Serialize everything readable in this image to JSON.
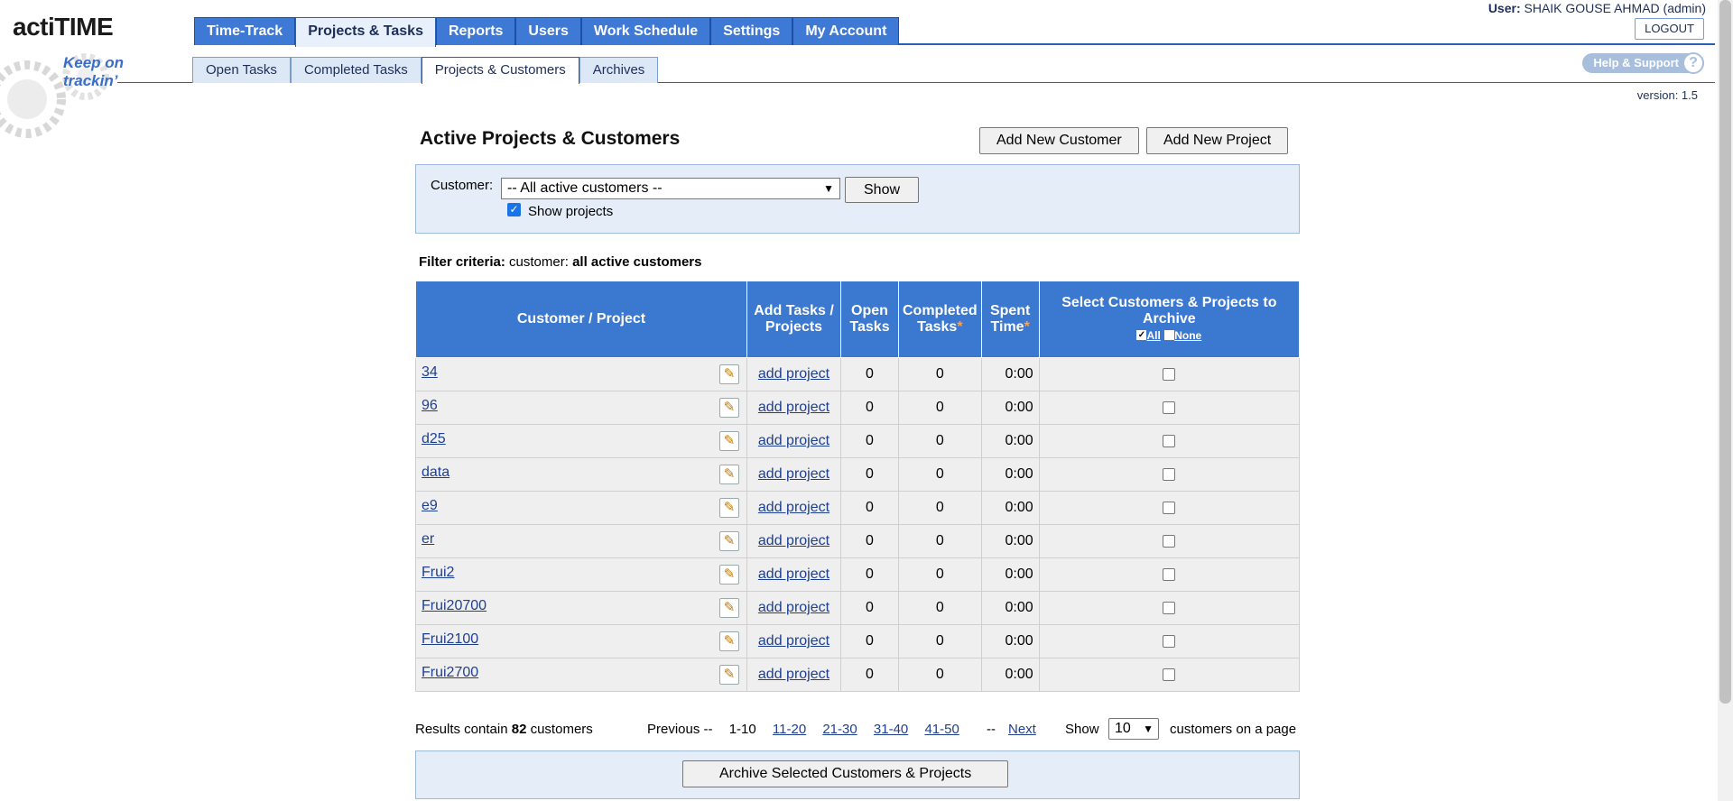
{
  "header": {
    "logo_text": "actiTIME",
    "tagline": "Keep on trackin’",
    "user_label": "User:",
    "user_name": "SHAIK GOUSE AHMAD (admin)",
    "logout_label": "LOGOUT",
    "help_label": "Help & Support",
    "help_icon": "?",
    "version": "version: 1.5",
    "top_tabs": [
      "Time-Track",
      "Projects & Tasks",
      "Reports",
      "Users",
      "Work Schedule",
      "Settings",
      "My Account"
    ],
    "active_top_tab": "Projects & Tasks",
    "sub_tabs": [
      "Open Tasks",
      "Completed Tasks",
      "Projects & Customers",
      "Archives"
    ],
    "active_sub_tab": "Projects & Customers"
  },
  "page": {
    "title": "Active Projects & Customers",
    "add_customer_label": "Add New Customer",
    "add_project_label": "Add New Project"
  },
  "filter": {
    "customer_label": "Customer:",
    "customer_value": "-- All active customers --",
    "show_label": "Show",
    "show_projects_label": "Show projects",
    "show_projects_checked": true,
    "criteria_label": "Filter criteria:",
    "criteria_key": "customer:",
    "criteria_value": "all active customers"
  },
  "table": {
    "headers": {
      "customer_project": "Customer / Project",
      "add_tasks": "Add Tasks / Projects",
      "open_tasks": "Open Tasks",
      "completed_tasks": "Completed Tasks",
      "spent_time": "Spent Time",
      "archive": "Select Customers & Projects to Archive",
      "star": "*",
      "all_link": "All",
      "none_link": "None"
    },
    "rows": [
      {
        "name": "34",
        "action": "add project",
        "open": "0",
        "completed": "0",
        "spent": "0:00"
      },
      {
        "name": "96",
        "action": "add project",
        "open": "0",
        "completed": "0",
        "spent": "0:00"
      },
      {
        "name": "d25",
        "action": "add project",
        "open": "0",
        "completed": "0",
        "spent": "0:00"
      },
      {
        "name": "data",
        "action": "add project",
        "open": "0",
        "completed": "0",
        "spent": "0:00"
      },
      {
        "name": "e9",
        "action": "add project",
        "open": "0",
        "completed": "0",
        "spent": "0:00"
      },
      {
        "name": "er",
        "action": "add project",
        "open": "0",
        "completed": "0",
        "spent": "0:00"
      },
      {
        "name": "Frui2",
        "action": "add project",
        "open": "0",
        "completed": "0",
        "spent": "0:00"
      },
      {
        "name": "Frui20700",
        "action": "add project",
        "open": "0",
        "completed": "0",
        "spent": "0:00"
      },
      {
        "name": "Frui2100",
        "action": "add project",
        "open": "0",
        "completed": "0",
        "spent": "0:00"
      },
      {
        "name": "Frui2700",
        "action": "add project",
        "open": "0",
        "completed": "0",
        "spent": "0:00"
      }
    ]
  },
  "results": {
    "prefix": "Results contain",
    "count": "82",
    "suffix": "customers",
    "previous": "Previous --",
    "pages": [
      "1-10",
      "11-20",
      "21-30",
      "31-40",
      "41-50"
    ],
    "next_prefix": "--",
    "next": "Next",
    "show_label": "Show",
    "page_size": "10",
    "per_page_label": "customers on a page"
  },
  "archive_button_label": "Archive Selected Customers & Projects",
  "icons": {
    "edit": "edit-icon",
    "help": "help-icon",
    "select_chevron": "chevron-down-icon"
  },
  "colors": {
    "tab_blue": "#3e79d6",
    "header_blue": "#3b78d0",
    "filter_bg": "#e4edf8",
    "asterisk": "#f4a261"
  }
}
